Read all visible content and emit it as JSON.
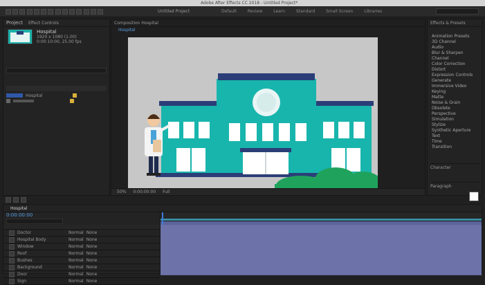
{
  "window": {
    "title_bar": "Adobe After Effects CC 2018 - Untitled Project*",
    "title_indicator": "Untitled Project",
    "menu_tabs": [
      "Default",
      "Review",
      "Learn",
      "Standard",
      "Small Screen",
      "Libraries"
    ]
  },
  "project": {
    "panel_title": "Project",
    "tabs": [
      "Project",
      "Effect Controls"
    ],
    "comp_name": "Hospital",
    "comp_details": [
      "1920 x 1080 (1.00)",
      "0:00:10:00, 25.00 fps"
    ],
    "list_row_label": "Hospital",
    "search_placeholder": "Search"
  },
  "composition": {
    "panel_title": "Composition Hospital",
    "tab_label": "Hospital",
    "zoom": "50%",
    "resolution": "Full",
    "timecode": "0:00:00:00"
  },
  "effects_presets": {
    "title": "Effects & Presets",
    "items": [
      "Animation Presets",
      "3D Channel",
      "Audio",
      "Blur & Sharpen",
      "Channel",
      "Color Correction",
      "Distort",
      "Expression Controls",
      "Generate",
      "Immersive Video",
      "Keying",
      "Matte",
      "Noise & Grain",
      "Obsolete",
      "Perspective",
      "Simulation",
      "Stylize",
      "Synthetic Aperture",
      "Text",
      "Time",
      "Transition"
    ],
    "section_text_title": "Character",
    "section_paragraph_title": "Paragraph"
  },
  "timeline": {
    "tab_label": "Hospital",
    "timecode": "0:00:00:00",
    "layer_names": [
      "Doctor",
      "Hospital Body",
      "Window",
      "Roof",
      "Bushes",
      "Background",
      "Door",
      "Sign"
    ],
    "mode_value": "Normal",
    "parent_value": "None"
  },
  "colors": {
    "ui_bg": "#202020",
    "canvas_bg": "#c7c7c7",
    "teal": "#18b5ad",
    "navy": "#2b3e78",
    "track_purple": "#6d73a8",
    "bush_green": "#1fa35c"
  }
}
